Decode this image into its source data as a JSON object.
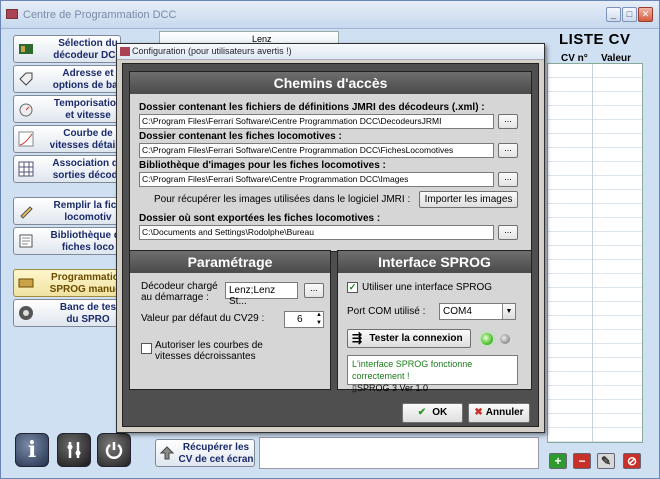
{
  "main_window": {
    "title": "Centre de Programmation DCC",
    "decoder_strip_text": "Lenz"
  },
  "sidebar": {
    "items": [
      {
        "line1": "Sélection du",
        "line2": "décodeur DCC"
      },
      {
        "line1": "Adresse et",
        "line2": "options de bas"
      },
      {
        "line1": "Temporisation",
        "line2": "et vitesse"
      },
      {
        "line1": "Courbe de",
        "line2": "vitesses détaillé"
      },
      {
        "line1": "Association de",
        "line2": "sorties décode"
      },
      {
        "line1": "Remplir la fich",
        "line2": "locomotiv"
      },
      {
        "line1": "Bibliothèque de",
        "line2": "fiches loco"
      },
      {
        "line1": "Programmation",
        "line2": "SPROG manuell"
      },
      {
        "line1": "Banc de tes",
        "line2": "du SPRO"
      }
    ]
  },
  "bottom": {
    "info_glyph": "i",
    "recup_line1": "Récupérer les",
    "recup_line2": "CV de cet écran"
  },
  "cv_panel": {
    "title": "LISTE CV",
    "col_cv": "CV n°",
    "col_value": "Valeur"
  },
  "dialog": {
    "title": "Configuration (pour utilisateurs avertis !)",
    "paths": {
      "heading": "Chemins d'accès",
      "jmri_label": "Dossier contenant les fichiers de définitions JMRI des décodeurs (.xml) :",
      "jmri_value": "C:\\Program Files\\Ferrari Software\\Centre Programmation DCC\\DecodeursJRMI",
      "loco_label": "Dossier contenant les fiches locomotives :",
      "loco_value": "C:\\Program Files\\Ferrari Software\\Centre Programmation DCC\\FichesLocomotives",
      "images_label": "Bibliothèque d'images pour les fiches locomotives :",
      "images_value": "C:\\Program Files\\Ferrari Software\\Centre Programmation DCC\\Images",
      "import_hint": "Pour récupérer les images utilisées dans le logiciel JMRI :",
      "import_button": "Importer les images",
      "export_label": "Dossier où sont exportées les fiches locomotives :",
      "export_value": "C:\\Documents and Settings\\Rodolphe\\Bureau",
      "browse_label": "..."
    },
    "settings": {
      "heading": "Paramétrage",
      "decoder_label_1": "Décodeur chargé",
      "decoder_label_2": "au démarrage :",
      "decoder_value": "Lenz;Lenz St...",
      "cv29_label": "Valeur par défaut du CV29 :",
      "cv29_value": "6",
      "curves_label_1": "Autoriser les courbes de",
      "curves_label_2": "vitesses décroissantes",
      "curves_checked": false
    },
    "sprog": {
      "heading": "Interface SPROG",
      "use_label": "Utiliser une interface SPROG",
      "use_checked": true,
      "port_label": "Port COM utilisé :",
      "port_value": "COM4",
      "test_button": "Tester la connexion",
      "status_line1": "L'interface SPROG fonctionne correctement !",
      "status_line2": "SPROG 3 Ver 1.0"
    },
    "ok_button": "OK",
    "cancel_button": "Annuler"
  }
}
